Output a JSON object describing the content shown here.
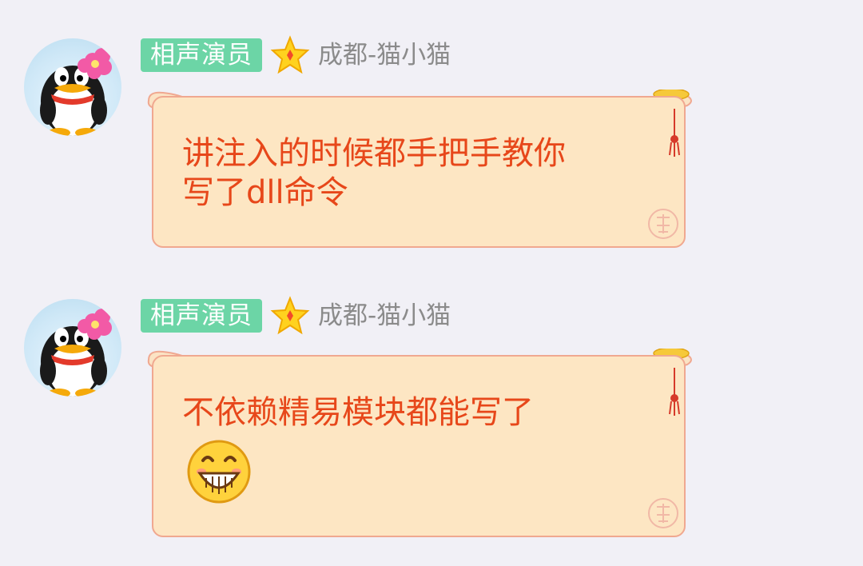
{
  "messages": [
    {
      "avatar_icon": "qq-penguin-avatar",
      "role_badge": "相声演员",
      "rank_icon": "star-icon",
      "username": "成都-猫小猫",
      "text_line1": "讲注入的时候都手把手教你",
      "text_line2": "写了dll命令"
    },
    {
      "avatar_icon": "qq-penguin-avatar",
      "role_badge": "相声演员",
      "rank_icon": "star-icon",
      "username": "成都-猫小猫",
      "text_line1": "不依赖精易模块都能写了",
      "emoji": "grinning-emoji-icon"
    }
  ],
  "colors": {
    "background": "#f1f0f6",
    "badge_bg": "#6cd5a6",
    "username": "#8b8b8b",
    "bubble_bg": "#fde6c3",
    "bubble_text": "#e7471a",
    "bubble_border": "#f0a890"
  }
}
